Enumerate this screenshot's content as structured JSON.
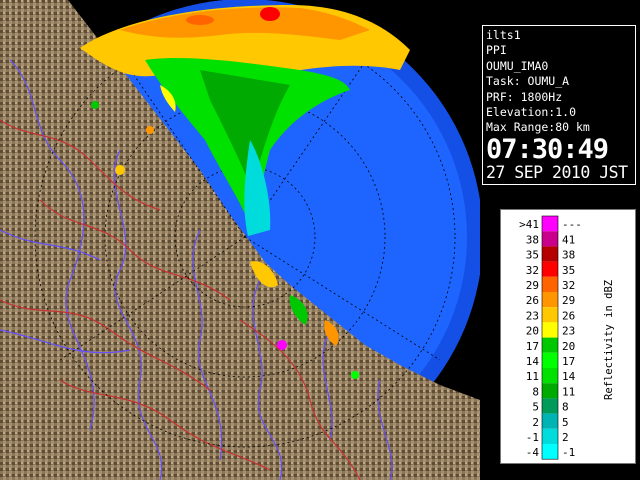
{
  "radar_info": {
    "site": "ilts1",
    "mode": "PPI",
    "product": "OUMU_IMA0",
    "task": "Task: OUMU_A",
    "prf": "PRF: 1800Hz",
    "elevation": "Elevation:1.0",
    "max_range": "Max Range:80 km",
    "time": "07:30:49",
    "date": "27 SEP 2010 JST"
  },
  "legend": {
    "title": "Reflectivity in dBZ",
    "rows": [
      {
        "left": ">41",
        "right": "---",
        "color": "#ff00ff"
      },
      {
        "left": "38",
        "right": "41",
        "color": "#c8008c"
      },
      {
        "left": "35",
        "right": "38",
        "color": "#b40000"
      },
      {
        "left": "32",
        "right": "35",
        "color": "#ff0000"
      },
      {
        "left": "29",
        "right": "32",
        "color": "#ff6400"
      },
      {
        "left": "26",
        "right": "29",
        "color": "#ff9600"
      },
      {
        "left": "23",
        "right": "26",
        "color": "#ffc800"
      },
      {
        "left": "20",
        "right": "23",
        "color": "#ffff00"
      },
      {
        "left": "17",
        "right": "20",
        "color": "#00c800"
      },
      {
        "left": "14",
        "right": "17",
        "color": "#00ff00"
      },
      {
        "left": "11",
        "right": "14",
        "color": "#00e100"
      },
      {
        "left": "8",
        "right": "11",
        "color": "#00aa00"
      },
      {
        "left": "5",
        "right": "8",
        "color": "#009b5a"
      },
      {
        "left": "2",
        "right": "5",
        "color": "#00b4b4"
      },
      {
        "left": "-1",
        "right": "2",
        "color": "#00dcdc"
      },
      {
        "left": "-4",
        "right": "-1",
        "color": "#00ffff"
      }
    ]
  },
  "map_colors": {
    "sea_inner": "#1e64ff",
    "sea_outer": "#1450e6",
    "land": "#8c7a5a",
    "land_dark": "#5a4a32",
    "rivers": "#6450ff",
    "borders": "#c83232"
  }
}
